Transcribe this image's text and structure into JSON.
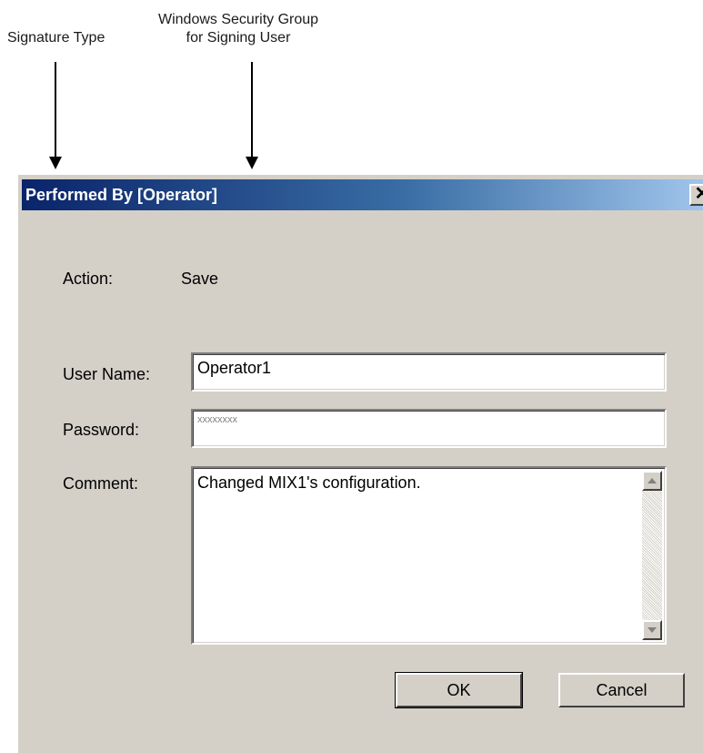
{
  "annotations": {
    "signature_type": "Signature Type",
    "security_group_line1": "Windows Security Group",
    "security_group_line2": "for Signing User"
  },
  "dialog": {
    "title": "Performed By [Operator]",
    "close_glyph": "✕",
    "action_label": "Action:",
    "action_value": "Save",
    "username_label": "User Name:",
    "username_value": "Operator1",
    "password_label": "Password:",
    "password_value": "xxxxxxxx",
    "comment_label": "Comment:",
    "comment_value": "Changed MIX1's configuration.",
    "ok_label": "OK",
    "cancel_label": "Cancel"
  },
  "colors": {
    "title_gradient_start": "#0a246a",
    "title_gradient_end": "#a6caf0",
    "dialog_face": "#d4d0c8"
  }
}
